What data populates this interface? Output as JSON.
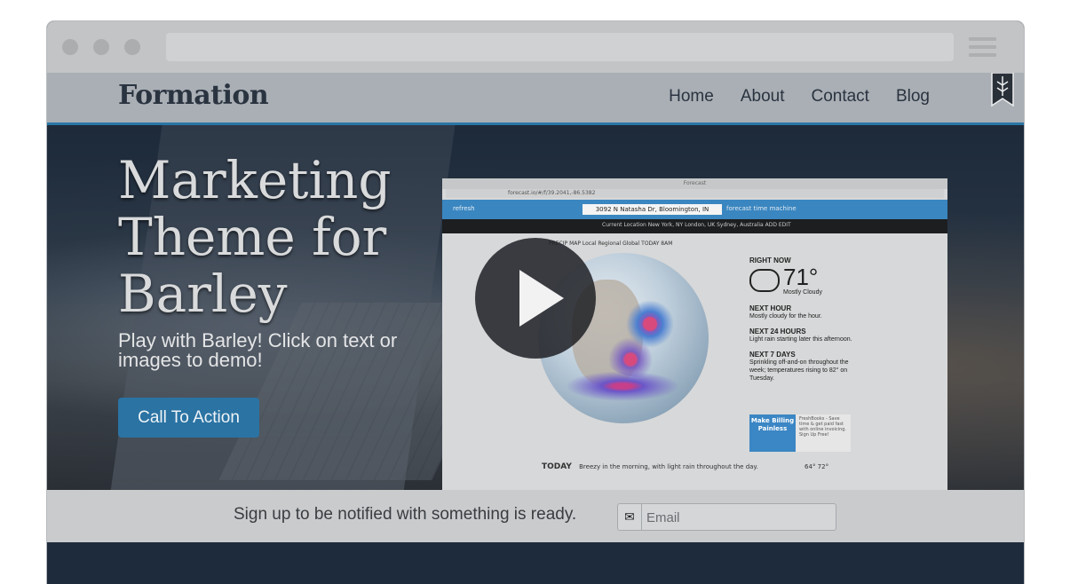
{
  "nav": {
    "brand": "Formation",
    "links": [
      "Home",
      "About",
      "Contact",
      "Blog"
    ]
  },
  "hero": {
    "title": "Marketing Theme for Barley",
    "subtitle": "Play with Barley! Click on text or images to demo!",
    "cta": "Call To Action"
  },
  "screenshot": {
    "window_title": "Forecast",
    "url": "forecast.io/#/f/39.2041,-86.5382",
    "refresh": "refresh",
    "address": "3092 N Natasha Dr, Bloomington, IN",
    "modes": "forecast   time machine",
    "locations": "Current Location   New York, NY   London, UK   Sydney, Australia   ADD   EDIT",
    "tabs": "PRECIP MAP   Local   Regional   Global   TODAY 8AM",
    "right_now": "RIGHT NOW",
    "temp": "71°",
    "condition": "Mostly Cloudy",
    "next_hour_h": "NEXT HOUR",
    "next_hour": "Mostly cloudy for the hour.",
    "next_24_h": "NEXT 24 HOURS",
    "next_24": "Light rain starting later this afternoon.",
    "next_7_h": "NEXT 7 DAYS",
    "next_7": "Sprinkling off-and-on throughout the week; temperatures rising to 82° on Tuesday.",
    "ad_title": "Make Billing Painless",
    "ad_text": "FreshBooks - Save time & get paid fast with online invoicing. Sign Up Free!",
    "today_label": "TODAY",
    "today_text": "Breezy in the morning, with light rain throughout the day.",
    "today_range": "64°  72°"
  },
  "signup": {
    "text": "Sign up to be notified with something is ready.",
    "placeholder": "Email"
  }
}
